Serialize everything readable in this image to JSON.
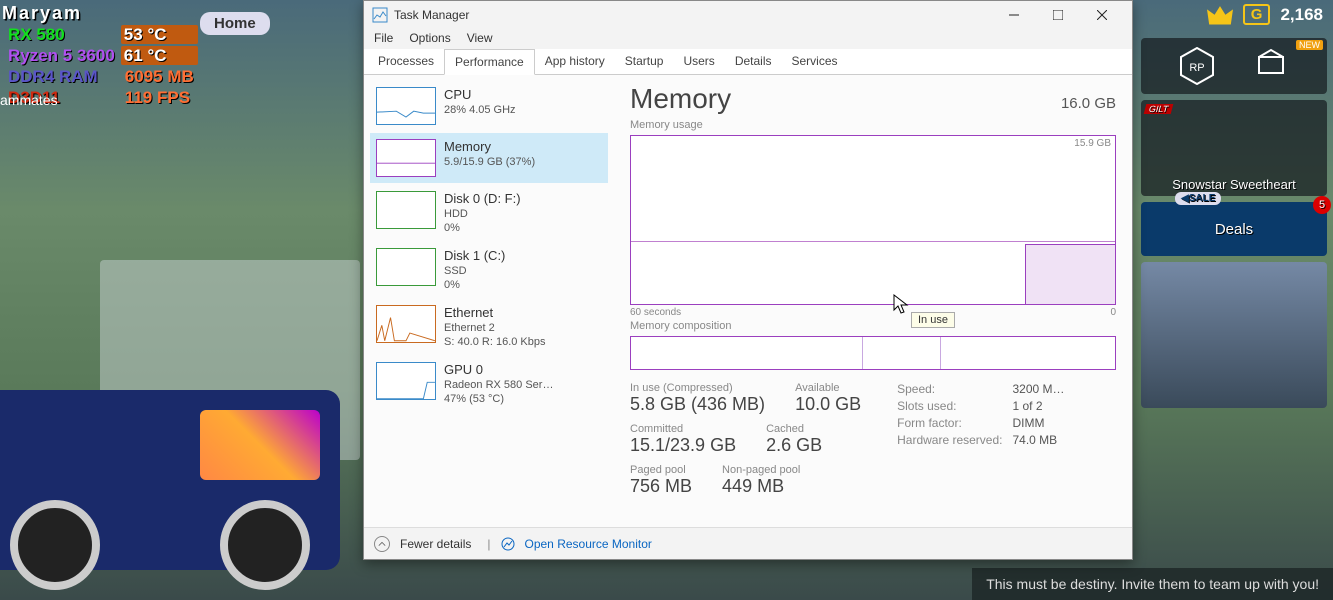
{
  "game": {
    "player_name": "Maryam",
    "home_label": "Home",
    "teammates_label": "ammates",
    "osd": {
      "gpu_name": "RX 580",
      "gpu_temp": "53",
      "temp_unit": "°C",
      "cpu_name": "Ryzen 5 3600",
      "cpu_temp": "61",
      "ram_name": "DDR4 RAM",
      "ram_val": "6095",
      "ram_unit": "MB",
      "api": "D3D11",
      "fps": "119",
      "fps_unit": "FPS"
    },
    "gcoin_label": "G",
    "gcoin_value": "2,168",
    "right": {
      "hex_label": "RP",
      "new_badge": "NEW",
      "gilt": "GILT",
      "card1": "Snowstar Sweetheart",
      "sale": "SALE",
      "deals": "Deals",
      "deals_badge": "5"
    },
    "destiny": "This must be destiny. Invite them to team up with you!"
  },
  "tm": {
    "title": "Task Manager",
    "menu": [
      "File",
      "Options",
      "View"
    ],
    "tabs": [
      "Processes",
      "Performance",
      "App history",
      "Startup",
      "Users",
      "Details",
      "Services"
    ],
    "active_tab": 1,
    "sidebar": [
      {
        "title": "CPU",
        "sub": "28%  4.05 GHz",
        "type": "cpu"
      },
      {
        "title": "Memory",
        "sub": "5.9/15.9 GB (37%)",
        "type": "mem",
        "selected": true
      },
      {
        "title": "Disk 0 (D: F:)",
        "sub": "HDD",
        "sub2": "0%",
        "type": "disk"
      },
      {
        "title": "Disk 1 (C:)",
        "sub": "SSD",
        "sub2": "0%",
        "type": "disk"
      },
      {
        "title": "Ethernet",
        "sub": "Ethernet 2",
        "sub2": "S: 40.0  R: 16.0 Kbps",
        "type": "eth"
      },
      {
        "title": "GPU 0",
        "sub": "Radeon RX 580 Ser…",
        "sub2": "47% (53 °C)",
        "type": "gpu"
      }
    ],
    "main": {
      "heading": "Memory",
      "capacity": "16.0 GB",
      "usage_label": "Memory usage",
      "graph_max": "15.9 GB",
      "graph_x_left": "60 seconds",
      "graph_x_right": "0",
      "tooltip": "In use",
      "comp_label": "Memory composition",
      "stats": {
        "inuse_k": "In use (Compressed)",
        "inuse_v": "5.8 GB (436 MB)",
        "avail_k": "Available",
        "avail_v": "10.0 GB",
        "commit_k": "Committed",
        "commit_v": "15.1/23.9 GB",
        "cached_k": "Cached",
        "cached_v": "2.6 GB",
        "paged_k": "Paged pool",
        "paged_v": "756 MB",
        "npaged_k": "Non-paged pool",
        "npaged_v": "449 MB",
        "speed_k": "Speed:",
        "speed_v": "3200 M…",
        "slots_k": "Slots used:",
        "slots_v": "1 of 2",
        "form_k": "Form factor:",
        "form_v": "DIMM",
        "hw_k": "Hardware reserved:",
        "hw_v": "74.0 MB"
      }
    },
    "footer": {
      "fewer": "Fewer details",
      "resmon": "Open Resource Monitor"
    }
  },
  "chart_data": {
    "type": "line",
    "title": "Memory usage",
    "ylabel": "GB",
    "ylim": [
      0,
      15.9
    ],
    "xlabel": "seconds",
    "xlim": [
      60,
      0
    ],
    "series": [
      {
        "name": "In use",
        "values": [
          5.9,
          5.9,
          5.9,
          5.9,
          5.9,
          5.9,
          5.9,
          5.8,
          5.8,
          5.8,
          5.8
        ]
      }
    ]
  }
}
